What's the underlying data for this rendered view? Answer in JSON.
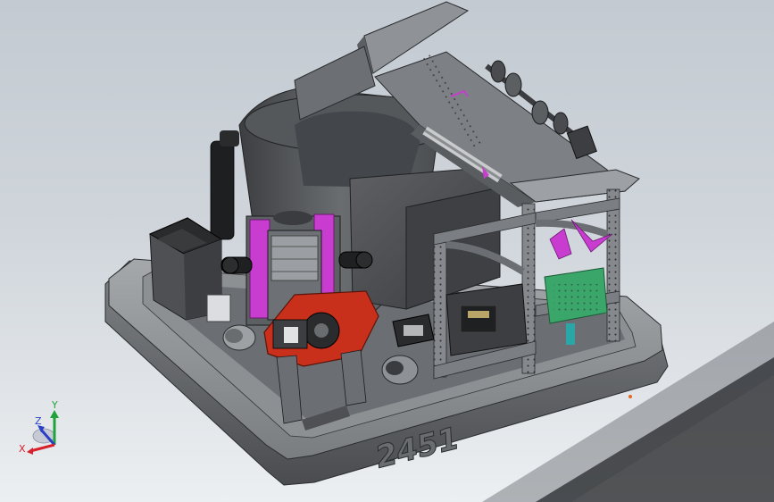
{
  "viewport": {
    "model_number_engraving": "2451",
    "background_top": "#c3cad1",
    "background_bottom": "#eceff1"
  },
  "triad": {
    "x_label": "X",
    "y_label": "Y",
    "z_label": "Z",
    "x_color": "#d8202a",
    "y_color": "#1fa33a",
    "z_color": "#2a3fc8"
  },
  "accent_colors": {
    "magenta_parts": "#c83cd0",
    "orange_red_plate": "#c8301c",
    "green_board": "#3aa66a",
    "gray_body": "#6f7276"
  }
}
